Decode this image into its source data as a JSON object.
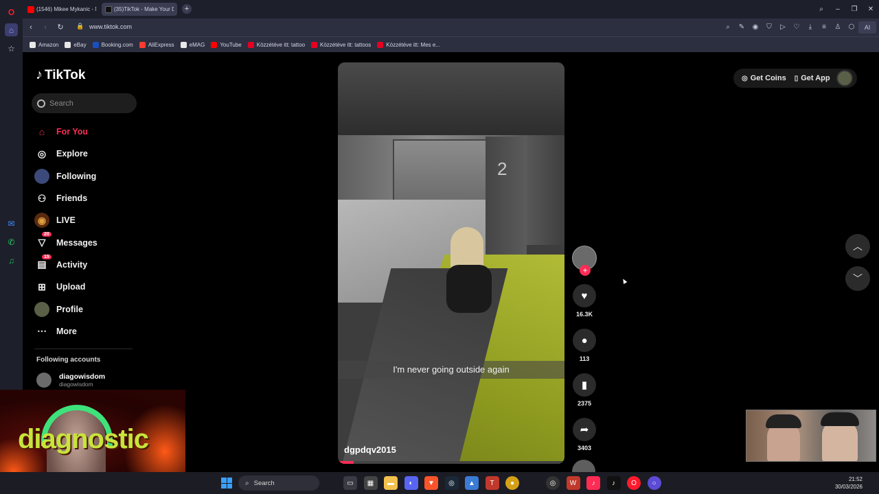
{
  "browser": {
    "tabs": [
      {
        "label": "(1546) Mikee Mykanic - N",
        "icon": "youtube-icon",
        "color": "#ff0000"
      },
      {
        "label": "(35)TikTok - Make Your Da",
        "icon": "tiktok-icon",
        "color": "#111111"
      }
    ],
    "new_tab": "+",
    "url": "www.tiktok.com",
    "ai_label": "AI",
    "bookmarks": [
      {
        "label": "Amazon",
        "color": "#e8e8e8"
      },
      {
        "label": "eBay",
        "color": "#e8e8e8"
      },
      {
        "label": "Booking.com",
        "color": "#1a4fbf"
      },
      {
        "label": "AliExpress",
        "color": "#ff3b2f"
      },
      {
        "label": "eMAG",
        "color": "#e8e8e8"
      },
      {
        "label": "YouTube",
        "color": "#ff0000"
      },
      {
        "label": "Közzétéve itt: tattoo",
        "color": "#e60023"
      },
      {
        "label": "Közzétéve itt: tattoos",
        "color": "#e60023"
      },
      {
        "label": "Közzétéve itt: Mes e...",
        "color": "#e60023"
      }
    ]
  },
  "tiktok": {
    "logo": "TikTok",
    "search_placeholder": "Search",
    "nav": [
      {
        "label": "For You",
        "icon": "home-icon",
        "active": true
      },
      {
        "label": "Explore",
        "icon": "compass-icon"
      },
      {
        "label": "Following",
        "icon": "following-avatar-icon"
      },
      {
        "label": "Friends",
        "icon": "friends-icon"
      },
      {
        "label": "LIVE",
        "icon": "live-icon"
      },
      {
        "label": "Messages",
        "icon": "messages-icon",
        "badge": "20"
      },
      {
        "label": "Activity",
        "icon": "activity-icon",
        "badge": "15"
      },
      {
        "label": "Upload",
        "icon": "upload-icon"
      },
      {
        "label": "Profile",
        "icon": "profile-avatar-icon"
      },
      {
        "label": "More",
        "icon": "more-icon"
      }
    ],
    "following_accounts_title": "Following accounts",
    "following_accounts": [
      {
        "name": "diagowisdom",
        "handle": "diagowisdom"
      }
    ],
    "top_right": {
      "get_coins": "Get Coins",
      "get_app": "Get App"
    },
    "video": {
      "caption": "I'm never going outside again",
      "username": "dgpdqv2015",
      "pillar_number": "2",
      "progress": 0.07
    },
    "actions": {
      "likes": "16.3K",
      "comments": "113",
      "saves": "2375",
      "shares": "3403"
    }
  },
  "overlay": {
    "webcam_text": "diagnostic"
  },
  "taskbar": {
    "search_label": "Search",
    "time": "21:52",
    "date": "30/03/2026"
  }
}
